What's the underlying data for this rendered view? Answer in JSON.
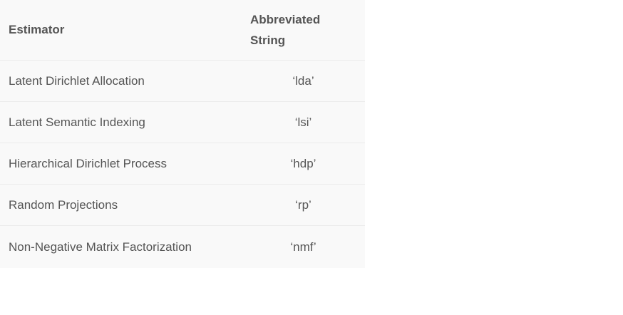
{
  "table": {
    "headers": {
      "estimator": "Estimator",
      "abbreviated_line1": "Abbreviated",
      "abbreviated_line2": "String"
    },
    "rows": [
      {
        "estimator": "Latent Dirichlet Allocation",
        "abbr": "‘lda’"
      },
      {
        "estimator": "Latent Semantic Indexing",
        "abbr": "‘lsi’"
      },
      {
        "estimator": "Hierarchical Dirichlet Process",
        "abbr": "‘hdp’"
      },
      {
        "estimator": "Random Projections",
        "abbr": "‘rp’"
      },
      {
        "estimator": "Non-Negative Matrix Factorization",
        "abbr": "‘nmf’"
      }
    ]
  }
}
